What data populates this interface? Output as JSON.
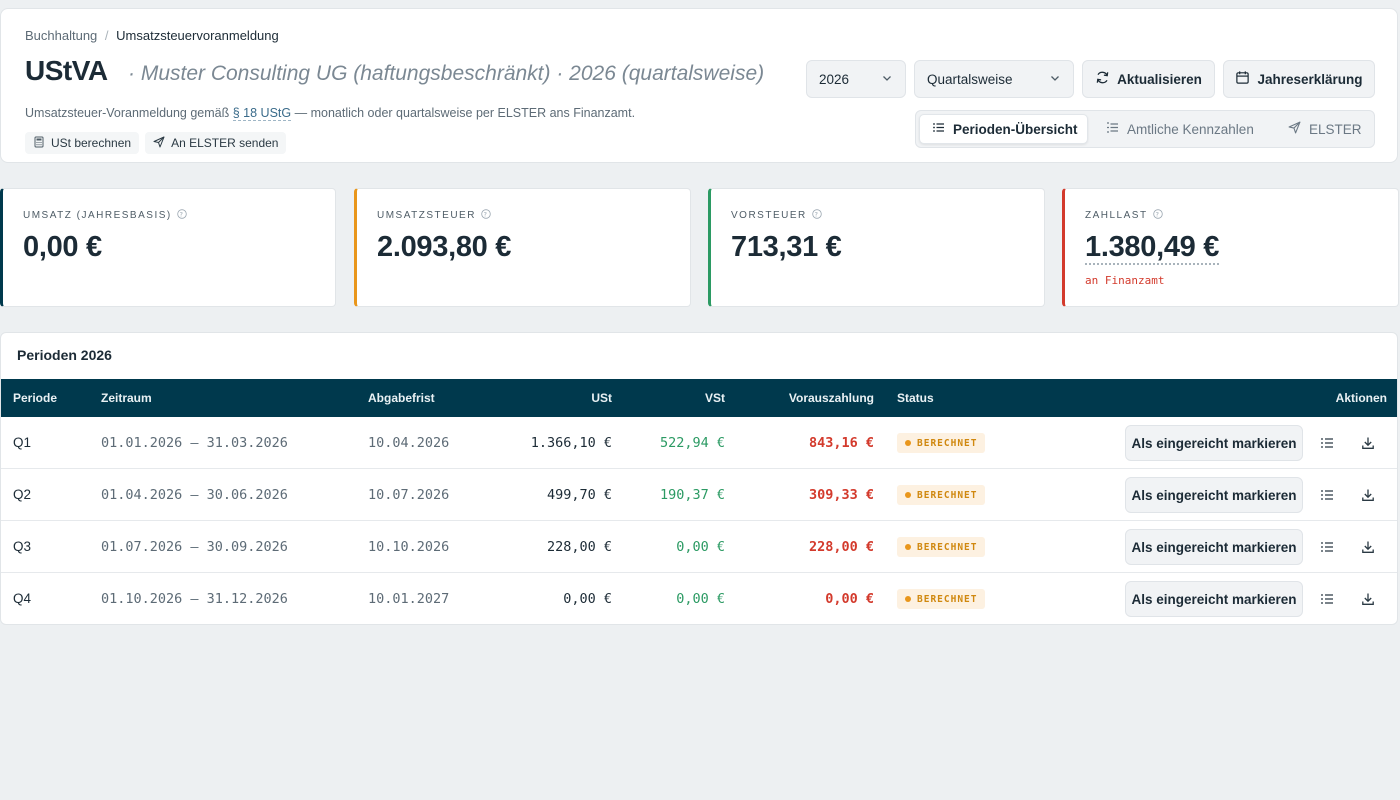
{
  "breadcrumb": {
    "parent": "Buchhaltung",
    "separator": "/",
    "current": "Umsatzsteuervoranmeldung"
  },
  "header": {
    "title": "UStVA",
    "subtitle": "· Muster Consulting UG (haftungsbeschränkt) · 2026 (quartalsweise)",
    "description_prefix": "Umsatzsteuer-Voranmeldung gemäß",
    "description_law": "§ 18 UStG",
    "description_suffix": "— monatlich oder quartalsweise per ELSTER ans Finanzamt.",
    "actions": [
      {
        "label": "USt berechnen",
        "icon": "calculator-icon"
      },
      {
        "label": "An ELSTER senden",
        "icon": "send-icon"
      }
    ]
  },
  "controls": {
    "year_select": "2026",
    "interval_select": "Quartalsweise",
    "refresh_label": "Aktualisieren",
    "annual_label": "Jahreserklärung"
  },
  "tabs": [
    {
      "label": "Perioden-Übersicht",
      "icon": "list-icon",
      "active": true
    },
    {
      "label": "Amtliche Kennzahlen",
      "icon": "list-numbers-icon",
      "active": false
    },
    {
      "label": "ELSTER",
      "icon": "send-icon",
      "active": false
    }
  ],
  "kpis": [
    {
      "label": "UMSATZ (JAHRESBASIS)",
      "value": "0,00 €",
      "accent": "#00394d",
      "note": ""
    },
    {
      "label": "UMSATZSTEUER",
      "value": "2.093,80 €",
      "accent": "#e9961b",
      "note": ""
    },
    {
      "label": "VORSTEUER",
      "value": "713,31 €",
      "accent": "#2b9a63",
      "note": ""
    },
    {
      "label": "ZAHLLAST",
      "value": "1.380,49 €",
      "accent": "#d33a2c",
      "note": "an Finanzamt"
    }
  ],
  "periods": {
    "title": "Perioden 2026",
    "columns": [
      "Periode",
      "Zeitraum",
      "Abgabefrist",
      "USt",
      "VSt",
      "Vorauszahlung",
      "Status",
      "Aktionen"
    ],
    "rows": [
      {
        "period": "Q1",
        "range": "01.01.2026 — 31.03.2026",
        "deadline": "10.04.2026",
        "ust": "1.366,10 €",
        "vst": "522,94 €",
        "payment": "843,16 €",
        "status": "BERECHNET",
        "action": "Als eingereicht markieren"
      },
      {
        "period": "Q2",
        "range": "01.04.2026 — 30.06.2026",
        "deadline": "10.07.2026",
        "ust": "499,70 €",
        "vst": "190,37 €",
        "payment": "309,33 €",
        "status": "BERECHNET",
        "action": "Als eingereicht markieren"
      },
      {
        "period": "Q3",
        "range": "01.07.2026 — 30.09.2026",
        "deadline": "10.10.2026",
        "ust": "228,00 €",
        "vst": "0,00 €",
        "payment": "228,00 €",
        "status": "BERECHNET",
        "action": "Als eingereicht markieren"
      },
      {
        "period": "Q4",
        "range": "01.10.2026 — 31.12.2026",
        "deadline": "10.01.2027",
        "ust": "0,00 €",
        "vst": "0,00 €",
        "payment": "0,00 €",
        "status": "BERECHNET",
        "action": "Als eingereicht markieren"
      }
    ]
  },
  "colors": {
    "header_bar": "#00394d",
    "status_pending": "#e9961b",
    "positive": "#2b9a63",
    "negative": "#d33a2c"
  }
}
